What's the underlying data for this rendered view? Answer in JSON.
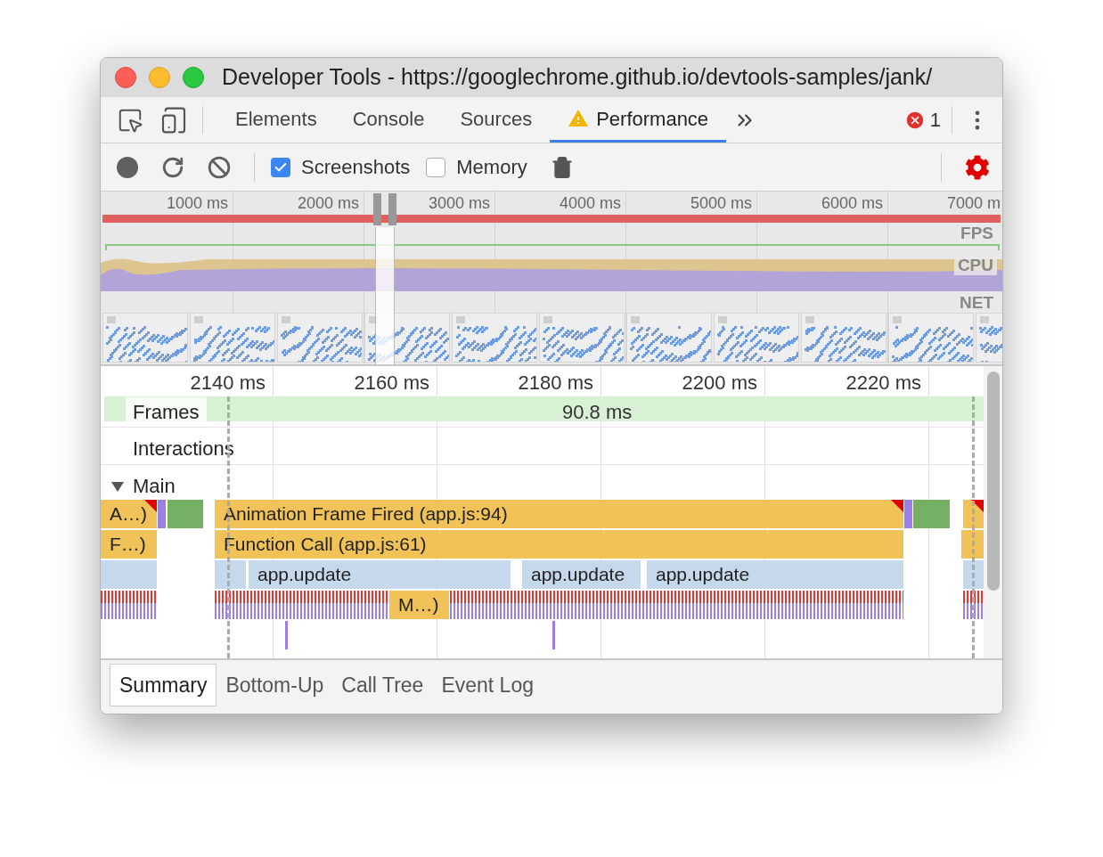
{
  "window": {
    "title": "Developer Tools - https://googlechrome.github.io/devtools-samples/jank/"
  },
  "tabs": [
    {
      "label": "Elements",
      "selected": false,
      "warning": false
    },
    {
      "label": "Console",
      "selected": false,
      "warning": false
    },
    {
      "label": "Sources",
      "selected": false,
      "warning": false
    },
    {
      "label": "Performance",
      "selected": true,
      "warning": true
    }
  ],
  "error_count": "1",
  "toolbar": {
    "checkboxes": [
      {
        "label": "Screenshots",
        "checked": true
      },
      {
        "label": "Memory",
        "checked": false
      }
    ]
  },
  "overview": {
    "ruler": [
      "1000 ms",
      "2000 ms",
      "3000 ms",
      "4000 ms",
      "5000 ms",
      "6000 ms",
      "7000 m"
    ],
    "tracks": [
      "FPS",
      "CPU",
      "NET"
    ]
  },
  "timeline": {
    "ruler": [
      "2140 ms",
      "2160 ms",
      "2180 ms",
      "2200 ms",
      "2220 ms"
    ],
    "frames": {
      "label": "Frames",
      "duration": "90.8 ms"
    },
    "tracks": [
      {
        "label": "Interactions"
      },
      {
        "label": "Main",
        "expanded": true
      }
    ],
    "flame": [
      {
        "kind": "script",
        "label": "A…)",
        "warning": true
      },
      {
        "kind": "layout",
        "warning": false
      },
      {
        "kind": "paint",
        "warning": false
      },
      {
        "kind": "script",
        "label": "Animation Frame Fired (app.js:94)",
        "warning": true
      },
      {
        "kind": "layout",
        "warning": false
      },
      {
        "kind": "paint",
        "warning": false
      },
      {
        "kind": "script",
        "warning": true
      },
      {
        "kind": "script",
        "label": "F…)",
        "warning": false
      },
      {
        "kind": "script",
        "label": "Function Call (app.js:61)",
        "warning": false
      },
      {
        "kind": "script",
        "warning": false
      },
      {
        "kind": "function",
        "warning": false
      },
      {
        "kind": "function",
        "warning": false
      },
      {
        "kind": "function",
        "label": "app.update",
        "warning": false
      },
      {
        "kind": "function",
        "label": "app.update",
        "warning": false
      },
      {
        "kind": "function",
        "label": "app.update",
        "warning": false
      },
      {
        "kind": "function",
        "warning": false
      },
      {
        "kind": "script",
        "label": "M…)",
        "warning": false
      }
    ]
  },
  "bottom_tabs": [
    {
      "label": "Summary",
      "selected": true
    },
    {
      "label": "Bottom-Up",
      "selected": false
    },
    {
      "label": "Call Tree",
      "selected": false
    },
    {
      "label": "Event Log",
      "selected": false
    }
  ]
}
